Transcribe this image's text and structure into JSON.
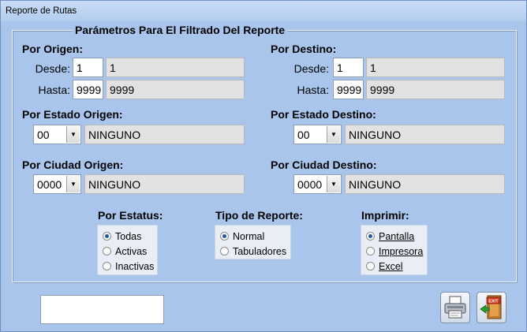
{
  "window": {
    "title": "Reporte de Rutas"
  },
  "filter_group": {
    "legend": "Parámetros Para El Filtrado Del Reporte"
  },
  "origen": {
    "label": "Por Origen:",
    "desde_label": "Desde:",
    "desde_code": "1",
    "desde_name": "1",
    "hasta_label": "Hasta:",
    "hasta_code": "9999",
    "hasta_name": "9999"
  },
  "destino": {
    "label": "Por Destino:",
    "desde_label": "Desde:",
    "desde_code": "1",
    "desde_name": "1",
    "hasta_label": "Hasta:",
    "hasta_code": "9999",
    "hasta_name": "9999"
  },
  "estado_origen": {
    "label": "Por Estado Origen:",
    "code": "00",
    "name": "NINGUNO"
  },
  "estado_destino": {
    "label": "Por Estado Destino:",
    "code": "00",
    "name": "NINGUNO"
  },
  "ciudad_origen": {
    "label": "Por Ciudad Origen:",
    "code": "0000",
    "name": "NINGUNO"
  },
  "ciudad_destino": {
    "label": "Por Ciudad Destino:",
    "code": "0000",
    "name": "NINGUNO"
  },
  "estatus": {
    "label": "Por Estatus:",
    "options": [
      "Todas",
      "Activas",
      "Inactivas"
    ],
    "selected": "Todas"
  },
  "tipo_reporte": {
    "label": "Tipo de Reporte:",
    "options": [
      "Normal",
      "Tabuladores"
    ],
    "selected": "Normal"
  },
  "imprimir": {
    "label": "Imprimir:",
    "options": [
      "Pantalla",
      "Impresora",
      "Excel"
    ],
    "selected": "Pantalla"
  },
  "toolbar": {
    "print_icon": "printer-icon",
    "exit_icon": "exit-door-icon",
    "exit_badge": "EXIT"
  },
  "colors": {
    "window_bg": "#a9c5ec",
    "radio_dot": "#2456a8",
    "readonly_bg": "#e2e2e2"
  }
}
